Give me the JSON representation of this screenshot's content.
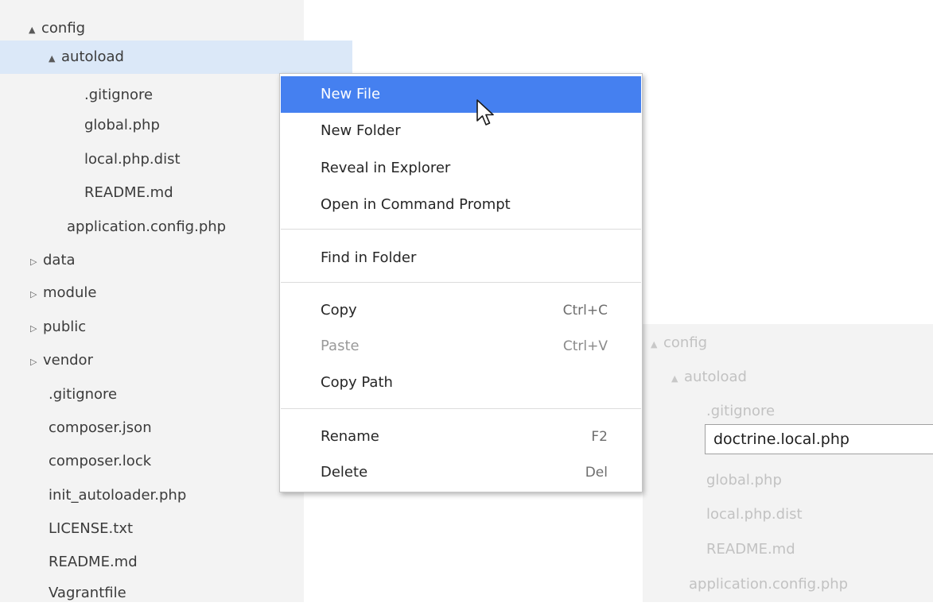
{
  "explorer": {
    "items": [
      {
        "label": "config",
        "toggle": "▲"
      },
      {
        "label": "autoload",
        "toggle": "▲"
      },
      {
        "label": ".gitignore"
      },
      {
        "label": "global.php"
      },
      {
        "label": "local.php.dist"
      },
      {
        "label": "README.md"
      },
      {
        "label": "application.config.php"
      },
      {
        "label": "data",
        "toggle": "▷"
      },
      {
        "label": "module",
        "toggle": "▷"
      },
      {
        "label": "public",
        "toggle": "▷"
      },
      {
        "label": "vendor",
        "toggle": "▷"
      },
      {
        "label": ".gitignore"
      },
      {
        "label": "composer.json"
      },
      {
        "label": "composer.lock"
      },
      {
        "label": "init_autoloader.php"
      },
      {
        "label": "LICENSE.txt"
      },
      {
        "label": "README.md"
      },
      {
        "label": "Vagrantfile"
      }
    ]
  },
  "context_menu": {
    "new_file": "New File",
    "new_folder": "New Folder",
    "reveal_in_explorer": "Reveal in Explorer",
    "open_in_command_prompt": "Open in Command Prompt",
    "find_in_folder": "Find in Folder",
    "copy": "Copy",
    "copy_shortcut": "Ctrl+C",
    "paste": "Paste",
    "paste_shortcut": "Ctrl+V",
    "copy_path": "Copy Path",
    "rename": "Rename",
    "rename_shortcut": "F2",
    "delete": "Delete",
    "delete_shortcut": "Del"
  },
  "ghost_tree": {
    "items": [
      {
        "label": "config",
        "toggle": "▲"
      },
      {
        "label": "autoload",
        "toggle": "▲"
      },
      {
        "label": ".gitignore"
      },
      {
        "label": "global.php"
      },
      {
        "label": "local.php.dist"
      },
      {
        "label": "README.md"
      },
      {
        "label": "application.config.php"
      }
    ],
    "new_file_input_value": "doctrine.local.php"
  },
  "colors": {
    "menu_highlight": "#4580f0",
    "selection": "#dbe8f8",
    "panel_background": "#f3f3f3"
  }
}
